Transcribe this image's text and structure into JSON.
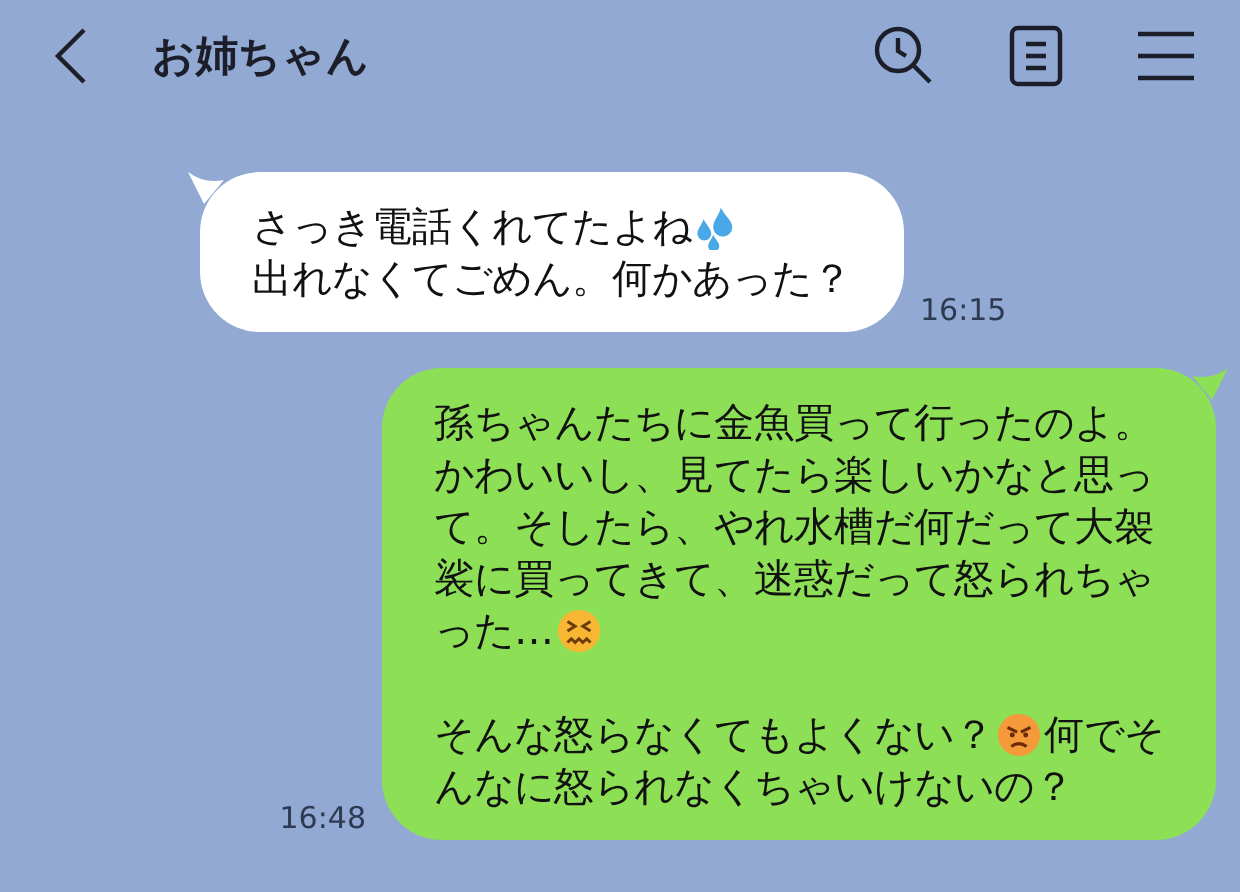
{
  "header": {
    "title": "お姉ちゃん"
  },
  "messages": [
    {
      "kind": "incoming",
      "time": "16:15",
      "paragraphs": [
        [
          [
            {
              "kind": "text",
              "text": "さっき電話くれてたよね"
            },
            {
              "kind": "sweat"
            }
          ],
          [
            {
              "kind": "text",
              "text": "出れなくてごめん。何かあった？"
            }
          ]
        ]
      ]
    },
    {
      "kind": "outgoing",
      "time": "16:48",
      "paragraphs": [
        [
          [
            {
              "kind": "text",
              "text": "孫ちゃんたちに金魚買って行ったのよ。"
            }
          ],
          [
            {
              "kind": "text",
              "text": "かわいいし、見てたら楽しいかなと思っ"
            }
          ],
          [
            {
              "kind": "text",
              "text": "て。そしたら、やれ水槽だ何だって大袈"
            }
          ],
          [
            {
              "kind": "text",
              "text": "裟に買ってきて、迷惑だって怒られちゃ"
            }
          ],
          [
            {
              "kind": "text",
              "text": "った…"
            },
            {
              "kind": "confounded"
            }
          ]
        ],
        [
          [
            {
              "kind": "text",
              "text": "そんな怒らなくてもよくない？"
            },
            {
              "kind": "angry"
            },
            {
              "kind": "text",
              "text": "何でそ"
            }
          ],
          [
            {
              "kind": "text",
              "text": "んなに怒られなくちゃいけないの？"
            }
          ]
        ]
      ]
    }
  ]
}
